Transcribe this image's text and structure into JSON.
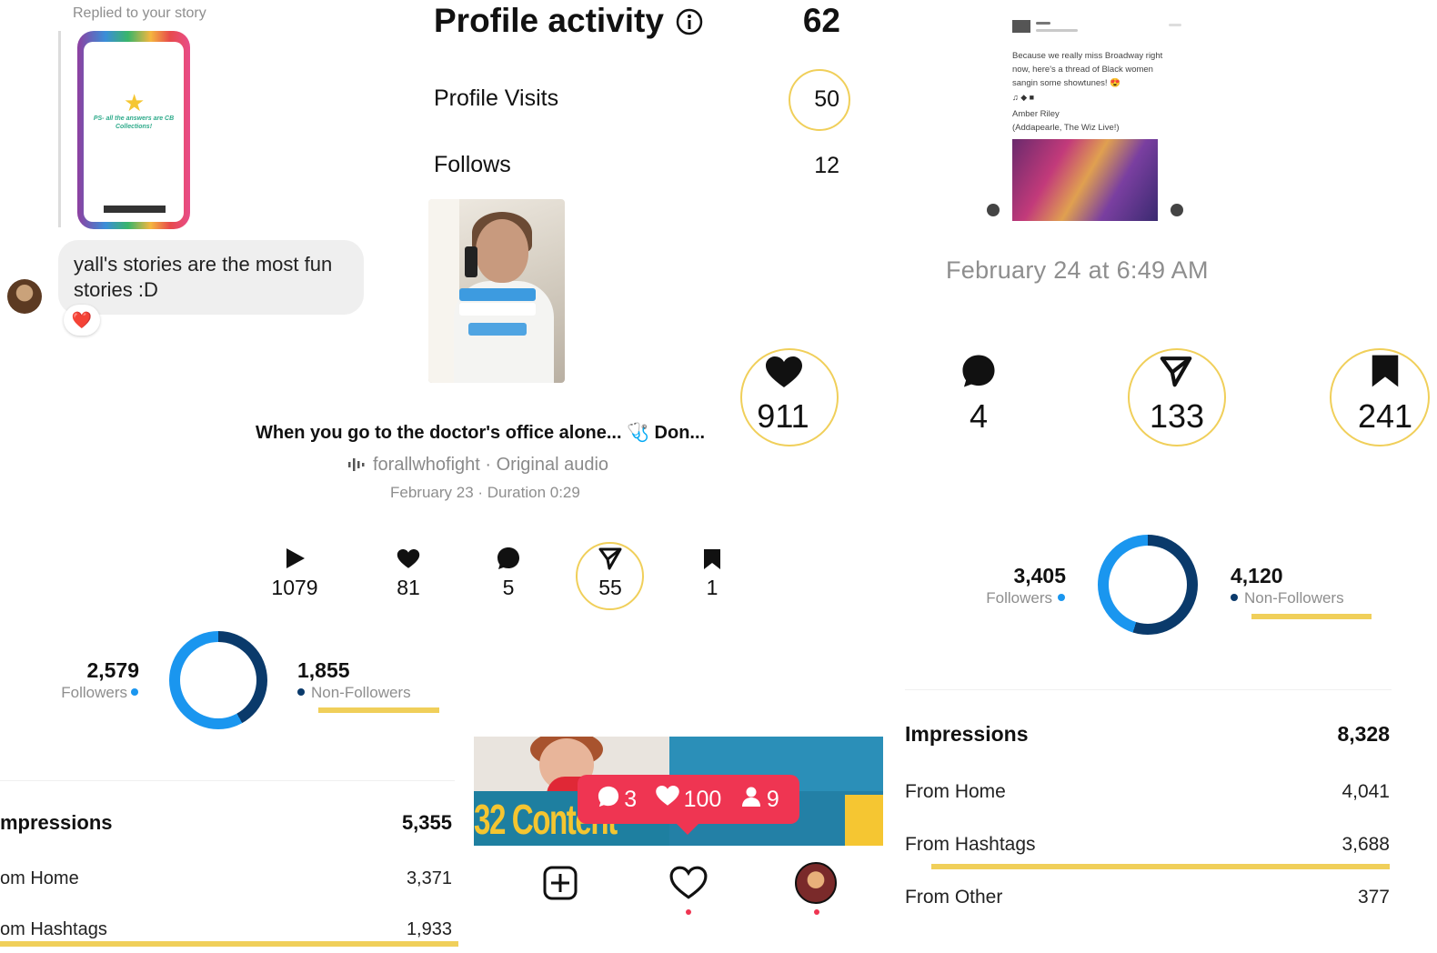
{
  "story_reply": {
    "caption": "Replied to your story",
    "story_text": "PS- all the answers are CB Collections!",
    "message": "yall's stories are the most fun stories :D",
    "reaction": "❤️"
  },
  "profile_activity": {
    "title": "Profile activity",
    "total": "62",
    "rows": [
      {
        "label": "Profile Visits",
        "value": "50"
      },
      {
        "label": "Follows",
        "value": "12"
      }
    ]
  },
  "reel": {
    "likes_big": "911",
    "title": "When you go to the doctor's office alone... 🩺 Don...",
    "audio": "forallwhofight · Original audio",
    "meta": "February 23 · Duration 0:29",
    "stats": [
      {
        "icon": "play-icon",
        "value": "1079"
      },
      {
        "icon": "heart-icon",
        "value": "81"
      },
      {
        "icon": "comment-icon",
        "value": "5"
      },
      {
        "icon": "share-icon",
        "value": "55"
      },
      {
        "icon": "bookmark-icon",
        "value": "1"
      }
    ],
    "followers_value": "2,579",
    "followers_label": "Followers",
    "nonfollowers_value": "1,855",
    "nonfollowers_label": "Non-Followers",
    "impressions": {
      "label": "mpressions",
      "value": "5,355",
      "rows": [
        {
          "label": "om Home",
          "value": "3,371"
        },
        {
          "label": "om Hashtags",
          "value": "1,933"
        }
      ]
    }
  },
  "notification": {
    "comments": "3",
    "likes": "100",
    "follows": "9",
    "collage_text": "32 Content"
  },
  "post": {
    "timestamp": "February 24 at 6:49 AM",
    "stats": [
      {
        "icon": "comment-icon",
        "value": "4"
      },
      {
        "icon": "share-icon",
        "value": "133"
      },
      {
        "icon": "bookmark-icon",
        "value": "241"
      }
    ],
    "followers_value": "3,405",
    "followers_label": "Followers",
    "nonfollowers_value": "4,120",
    "nonfollowers_label": "Non-Followers",
    "impressions": {
      "label": "Impressions",
      "value": "8,328",
      "rows": [
        {
          "label": "From Home",
          "value": "4,041"
        },
        {
          "label": "From Hashtags",
          "value": "3,688"
        },
        {
          "label": "From Other",
          "value": "377"
        }
      ]
    },
    "tweet": {
      "text": "Because we really miss Broadway right now, here's a thread of Black women sangin some showtunes! 😍",
      "credit_1": "Amber Riley",
      "credit_2": "(Addapearle, The Wiz Live!)"
    }
  },
  "colors": {
    "highlight": "#f0cf5a",
    "followers_blue": "#1a96ef",
    "nonfollowers_navy": "#0a3a6b",
    "notification_red": "#ef3552"
  }
}
